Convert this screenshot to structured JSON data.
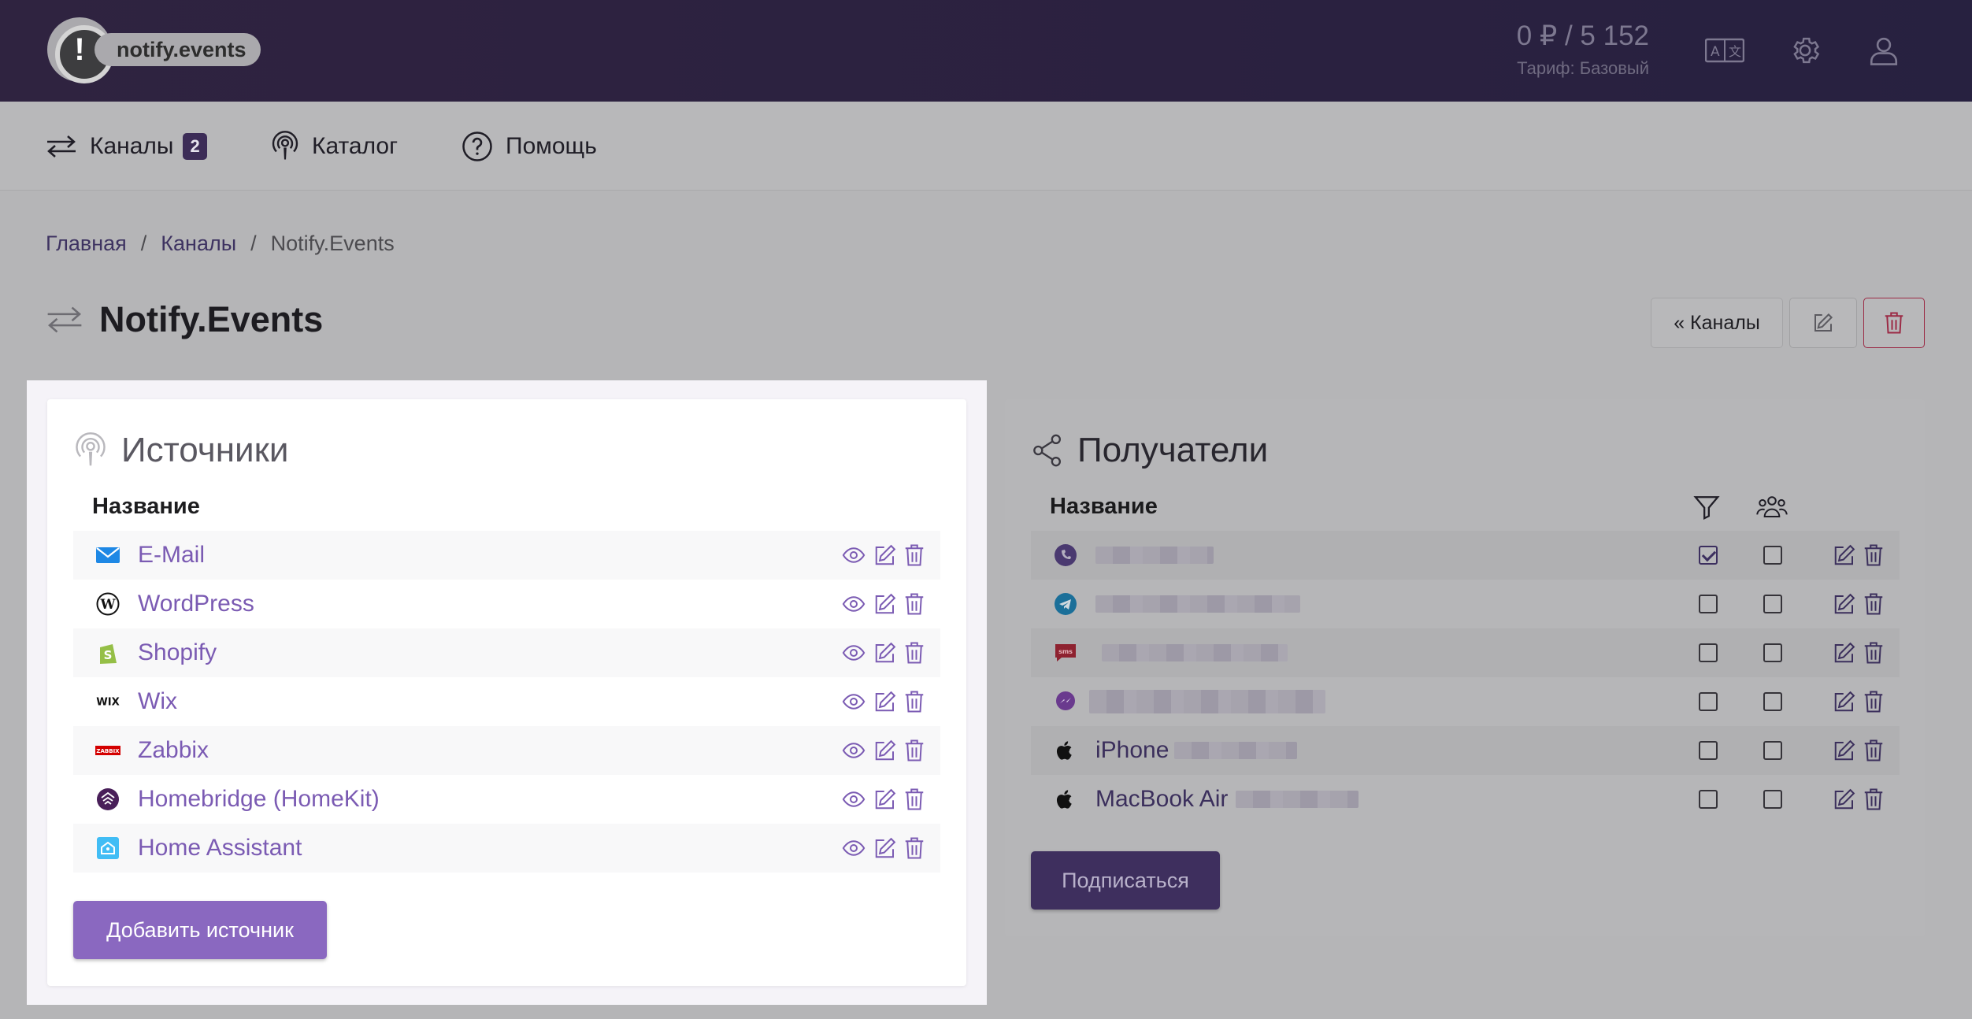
{
  "header": {
    "logo_text": "notify.events",
    "logo_mark": "!",
    "balance": "0 ₽ / 5 152",
    "tariff": "Тариф: Базовый",
    "icons": [
      "translate-icon",
      "gear-icon",
      "user-icon"
    ]
  },
  "nav": {
    "channels": "Каналы",
    "channels_badge": "2",
    "catalog": "Каталог",
    "help": "Помощь"
  },
  "breadcrumb": {
    "home": "Главная",
    "sep": "/",
    "channels": "Каналы",
    "current": "Notify.Events"
  },
  "page": {
    "title": "Notify.Events",
    "back_button": "« Каналы"
  },
  "sources": {
    "title": "Источники",
    "column_name": "Название",
    "items": [
      {
        "name": "E-Mail",
        "icon": "email-icon"
      },
      {
        "name": "WordPress",
        "icon": "wordpress-icon"
      },
      {
        "name": "Shopify",
        "icon": "shopify-icon"
      },
      {
        "name": "Wix",
        "icon": "wix-icon"
      },
      {
        "name": "Zabbix",
        "icon": "zabbix-icon"
      },
      {
        "name": "Homebridge (HomeKit)",
        "icon": "homebridge-icon"
      },
      {
        "name": "Home Assistant",
        "icon": "home-assistant-icon"
      }
    ],
    "add_button": "Добавить источник"
  },
  "recipients": {
    "title": "Получатели",
    "column_name": "Название",
    "items": [
      {
        "name": "",
        "icon": "viber-icon",
        "filter": true,
        "group": false
      },
      {
        "name": "",
        "icon": "telegram-icon",
        "filter": false,
        "group": false
      },
      {
        "name": "",
        "icon": "sms-icon",
        "filter": false,
        "group": false
      },
      {
        "name": "",
        "icon": "messenger-icon",
        "filter": false,
        "group": false
      },
      {
        "name": "iPhone",
        "icon": "apple-icon",
        "filter": false,
        "group": false
      },
      {
        "name": "MacBook Air",
        "icon": "apple-icon",
        "filter": false,
        "group": false
      }
    ],
    "subscribe_button": "Подписаться"
  },
  "colors": {
    "accent": "#8a68c0",
    "link": "#7b5bb3",
    "danger": "#9b2a45",
    "header_bg": "#2d2240"
  }
}
